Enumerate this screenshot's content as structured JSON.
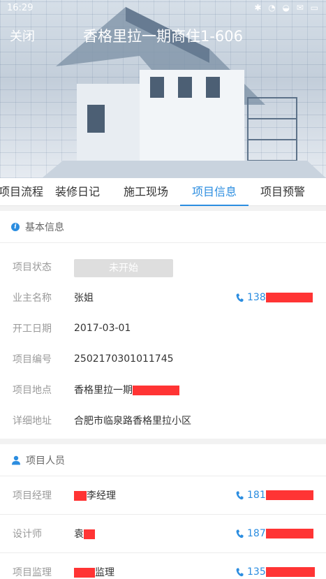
{
  "status_bar": {
    "time": "16:29"
  },
  "header": {
    "close_label": "关闭",
    "title": "香格里拉一期商住1-606"
  },
  "tabs": [
    "项目流程",
    "装修日记",
    "施工现场",
    "项目信息",
    "项目预警"
  ],
  "active_tab": 3,
  "basic_info": {
    "title": "基本信息",
    "status_label": "项目状态",
    "status_value": "未开始",
    "owner_label": "业主名称",
    "owner_value": "张姐",
    "owner_phone": "138",
    "start_label": "开工日期",
    "start_value": "2017-03-01",
    "number_label": "项目编号",
    "number_value": "2502170301011745",
    "location_label": "项目地点",
    "location_value": "香格里拉一期",
    "address_label": "详细地址",
    "address_value": "合肥市临泉路香格里拉小区"
  },
  "staff": {
    "title": "项目人员",
    "manager_label": "项目经理",
    "manager_value": "李经理",
    "manager_phone": "181",
    "designer_label": "设计师",
    "designer_value": "袁",
    "designer_phone": "187",
    "supervisor_label": "项目监理",
    "supervisor_value": "监理",
    "supervisor_phone": "135"
  },
  "colors": {
    "accent": "#2b8de0",
    "redaction": "#ff3434"
  }
}
